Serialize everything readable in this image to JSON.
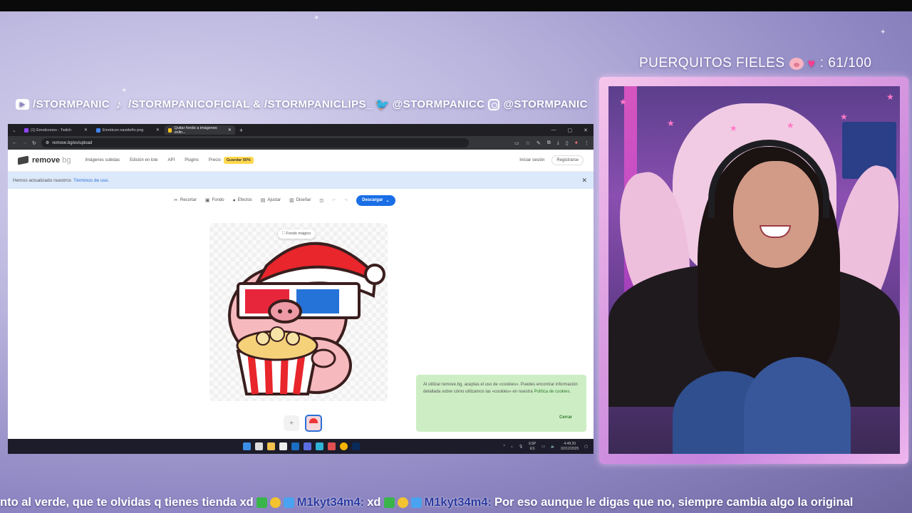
{
  "overlay": {
    "counter_label": "PUERQUITOS FIELES",
    "counter_value": ": 61/100",
    "socials": {
      "youtube": "/STORMPANIC",
      "tiktok": "/STORMPANICOFICIAL & /STORMPANICLIPS_",
      "twitter": "@STORMPANICC",
      "instagram": "@STORMPANIC"
    },
    "ticker": {
      "lead": "nto al verde, que te olvidas q tienes tienda xd",
      "user1": "M1kyt34m4:",
      "msg1": "xd",
      "user2": "M1kyt34m4:",
      "msg2": "Por eso aunque le digas que no, siempre cambia algo la original"
    }
  },
  "browser": {
    "tabs": [
      {
        "label": "(1) Emoticones - Twitch",
        "active": false
      },
      {
        "label": "Emoticon navideño png",
        "active": false
      },
      {
        "label": "Quitar fondo a imágenes onlin...",
        "active": true
      }
    ],
    "url": "remove.bg/es/upload",
    "site": {
      "logo_main": "remove",
      "logo_suffix": "bg",
      "nav": [
        "Imágenes subidas",
        "Edición en lote",
        "API",
        "Plugins",
        "Precio"
      ],
      "badge": "Guardar 50%",
      "login": "Iniciar sesión",
      "register": "Registrarse"
    },
    "notice": {
      "text": "Hemos actualizado nuestros",
      "link": "Términos de uso."
    },
    "toolbar": {
      "tools": [
        "Recortar",
        "Fondo",
        "Efectos",
        "Ajustar",
        "Diseñar"
      ],
      "download": "Descargar"
    },
    "canvas": {
      "magic_bg": "Fondo mágico"
    },
    "cookie": {
      "text": "Al utilizar remove.bg, aceptas el uso de «cookies». Puedes encontrar información detallada sobre cómo utilizamos las «cookies» en nuestra",
      "link": "Política de cookies.",
      "close": "Cerrar"
    },
    "taskbar": {
      "lang": "ESP",
      "lang_sub": "ES",
      "time": "4:49:20",
      "date": "02/12/2025"
    }
  },
  "colors": {
    "accent": "#1a6ee6",
    "badge": "#ffd84d",
    "cookie_bg": "#cdeec4",
    "notice_bg": "#dce9fb"
  }
}
